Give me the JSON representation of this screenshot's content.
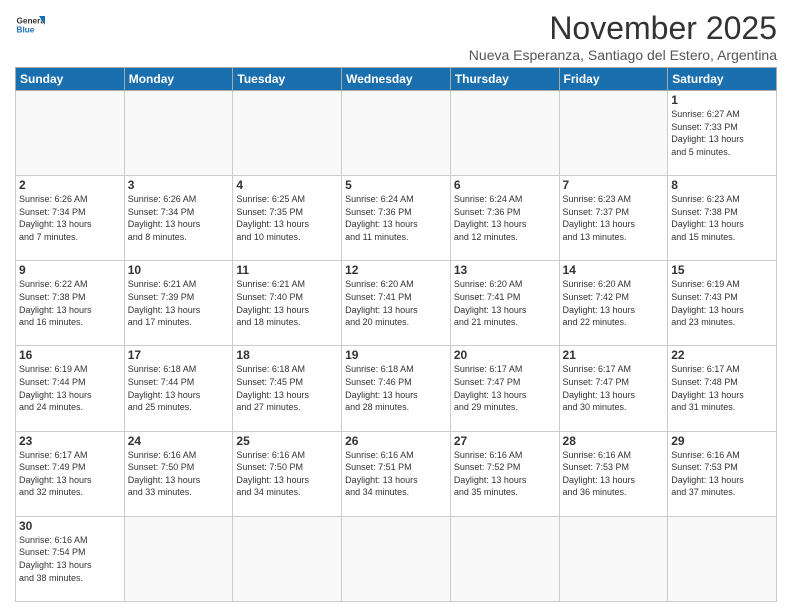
{
  "header": {
    "logo_general": "General",
    "logo_blue": "Blue",
    "month_title": "November 2025",
    "subtitle": "Nueva Esperanza, Santiago del Estero, Argentina"
  },
  "weekdays": [
    "Sunday",
    "Monday",
    "Tuesday",
    "Wednesday",
    "Thursday",
    "Friday",
    "Saturday"
  ],
  "weeks": [
    [
      {
        "day": "",
        "info": ""
      },
      {
        "day": "",
        "info": ""
      },
      {
        "day": "",
        "info": ""
      },
      {
        "day": "",
        "info": ""
      },
      {
        "day": "",
        "info": ""
      },
      {
        "day": "",
        "info": ""
      },
      {
        "day": "1",
        "info": "Sunrise: 6:27 AM\nSunset: 7:33 PM\nDaylight: 13 hours\nand 5 minutes."
      }
    ],
    [
      {
        "day": "2",
        "info": "Sunrise: 6:26 AM\nSunset: 7:34 PM\nDaylight: 13 hours\nand 7 minutes."
      },
      {
        "day": "3",
        "info": "Sunrise: 6:26 AM\nSunset: 7:34 PM\nDaylight: 13 hours\nand 8 minutes."
      },
      {
        "day": "4",
        "info": "Sunrise: 6:25 AM\nSunset: 7:35 PM\nDaylight: 13 hours\nand 10 minutes."
      },
      {
        "day": "5",
        "info": "Sunrise: 6:24 AM\nSunset: 7:36 PM\nDaylight: 13 hours\nand 11 minutes."
      },
      {
        "day": "6",
        "info": "Sunrise: 6:24 AM\nSunset: 7:36 PM\nDaylight: 13 hours\nand 12 minutes."
      },
      {
        "day": "7",
        "info": "Sunrise: 6:23 AM\nSunset: 7:37 PM\nDaylight: 13 hours\nand 13 minutes."
      },
      {
        "day": "8",
        "info": "Sunrise: 6:23 AM\nSunset: 7:38 PM\nDaylight: 13 hours\nand 15 minutes."
      }
    ],
    [
      {
        "day": "9",
        "info": "Sunrise: 6:22 AM\nSunset: 7:38 PM\nDaylight: 13 hours\nand 16 minutes."
      },
      {
        "day": "10",
        "info": "Sunrise: 6:21 AM\nSunset: 7:39 PM\nDaylight: 13 hours\nand 17 minutes."
      },
      {
        "day": "11",
        "info": "Sunrise: 6:21 AM\nSunset: 7:40 PM\nDaylight: 13 hours\nand 18 minutes."
      },
      {
        "day": "12",
        "info": "Sunrise: 6:20 AM\nSunset: 7:41 PM\nDaylight: 13 hours\nand 20 minutes."
      },
      {
        "day": "13",
        "info": "Sunrise: 6:20 AM\nSunset: 7:41 PM\nDaylight: 13 hours\nand 21 minutes."
      },
      {
        "day": "14",
        "info": "Sunrise: 6:20 AM\nSunset: 7:42 PM\nDaylight: 13 hours\nand 22 minutes."
      },
      {
        "day": "15",
        "info": "Sunrise: 6:19 AM\nSunset: 7:43 PM\nDaylight: 13 hours\nand 23 minutes."
      }
    ],
    [
      {
        "day": "16",
        "info": "Sunrise: 6:19 AM\nSunset: 7:44 PM\nDaylight: 13 hours\nand 24 minutes."
      },
      {
        "day": "17",
        "info": "Sunrise: 6:18 AM\nSunset: 7:44 PM\nDaylight: 13 hours\nand 25 minutes."
      },
      {
        "day": "18",
        "info": "Sunrise: 6:18 AM\nSunset: 7:45 PM\nDaylight: 13 hours\nand 27 minutes."
      },
      {
        "day": "19",
        "info": "Sunrise: 6:18 AM\nSunset: 7:46 PM\nDaylight: 13 hours\nand 28 minutes."
      },
      {
        "day": "20",
        "info": "Sunrise: 6:17 AM\nSunset: 7:47 PM\nDaylight: 13 hours\nand 29 minutes."
      },
      {
        "day": "21",
        "info": "Sunrise: 6:17 AM\nSunset: 7:47 PM\nDaylight: 13 hours\nand 30 minutes."
      },
      {
        "day": "22",
        "info": "Sunrise: 6:17 AM\nSunset: 7:48 PM\nDaylight: 13 hours\nand 31 minutes."
      }
    ],
    [
      {
        "day": "23",
        "info": "Sunrise: 6:17 AM\nSunset: 7:49 PM\nDaylight: 13 hours\nand 32 minutes."
      },
      {
        "day": "24",
        "info": "Sunrise: 6:16 AM\nSunset: 7:50 PM\nDaylight: 13 hours\nand 33 minutes."
      },
      {
        "day": "25",
        "info": "Sunrise: 6:16 AM\nSunset: 7:50 PM\nDaylight: 13 hours\nand 34 minutes."
      },
      {
        "day": "26",
        "info": "Sunrise: 6:16 AM\nSunset: 7:51 PM\nDaylight: 13 hours\nand 34 minutes."
      },
      {
        "day": "27",
        "info": "Sunrise: 6:16 AM\nSunset: 7:52 PM\nDaylight: 13 hours\nand 35 minutes."
      },
      {
        "day": "28",
        "info": "Sunrise: 6:16 AM\nSunset: 7:53 PM\nDaylight: 13 hours\nand 36 minutes."
      },
      {
        "day": "29",
        "info": "Sunrise: 6:16 AM\nSunset: 7:53 PM\nDaylight: 13 hours\nand 37 minutes."
      }
    ],
    [
      {
        "day": "30",
        "info": "Sunrise: 6:16 AM\nSunset: 7:54 PM\nDaylight: 13 hours\nand 38 minutes."
      },
      {
        "day": "",
        "info": ""
      },
      {
        "day": "",
        "info": ""
      },
      {
        "day": "",
        "info": ""
      },
      {
        "day": "",
        "info": ""
      },
      {
        "day": "",
        "info": ""
      },
      {
        "day": "",
        "info": ""
      }
    ]
  ]
}
